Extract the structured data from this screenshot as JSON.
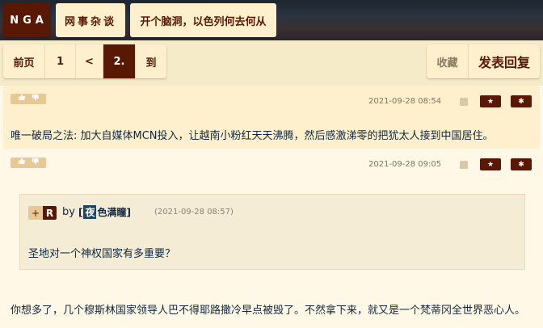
{
  "breadcrumb": {
    "logo": "NGA",
    "forum": "网事杂谈",
    "topic": "开个脑洞，以色列何去何从"
  },
  "pager": {
    "first": "前页",
    "page1": "1",
    "prev": "<",
    "current": "2.",
    "to": "到"
  },
  "actions": {
    "favorite": "收藏",
    "reply": "发表回复"
  },
  "posts": [
    {
      "date": "2021-09-28 08:54",
      "text": "唯一破局之法: 加大自媒体MCN投入，让越南小粉红天天沸腾，然后感激涕零的把犹太人接到中国居住。"
    },
    {
      "date": "2021-09-28 09:05",
      "quote": {
        "plus": "+",
        "tag": "R",
        "by": "by",
        "user_prefix": "[",
        "user_avatar_char": "夜",
        "user_name": "色满瞳",
        "user_suffix": "]",
        "date": "(2021-09-28 08:57)",
        "text": "圣地对一个神权国家有多重要？"
      },
      "text": "你想多了，几个穆斯林国家领导人巴不得耶路撒冷早点被毁了。不然拿下来，就又是一个梵蒂冈全世界恶心人。"
    }
  ],
  "icons": {
    "thumb_up": "thumb-up-icon",
    "thumb_down": "thumb-down-icon",
    "android": "android-icon",
    "star": "star-icon",
    "gear": "gear-icon"
  },
  "colors": {
    "brand": "#591804",
    "panel": "#fff0cd",
    "background": "#fff8e6"
  }
}
